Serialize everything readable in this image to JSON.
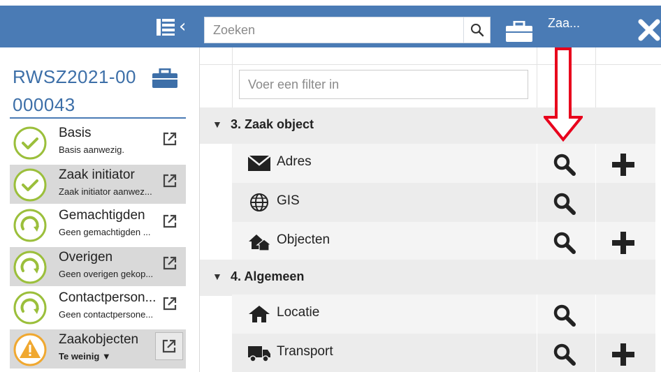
{
  "header": {
    "search_placeholder": "Zoeken",
    "title": "Zaa...",
    "collapse_glyph": "‹",
    "icons": [
      "list-icon",
      "chevron-left-icon",
      "search-icon",
      "briefcase-icon",
      "close-icon"
    ]
  },
  "case": {
    "id_line1": "RWSZ2021-00",
    "id_line2": "000043"
  },
  "steps": [
    {
      "title": "Basis",
      "subtitle": "Basis aanwezig.",
      "status": "complete"
    },
    {
      "title": "Zaak initiator",
      "subtitle": "Zaak initiator aanwez...",
      "status": "complete"
    },
    {
      "title": "Gemachtigden",
      "subtitle": "Geen gemachtigden ...",
      "status": "pending"
    },
    {
      "title": "Overigen",
      "subtitle": "Geen overigen gekop...",
      "status": "pending"
    },
    {
      "title": "Contactperson...",
      "subtitle": "Geen contactpersone...",
      "status": "pending"
    },
    {
      "title": "Zaakobjecten",
      "subtitle": "Te weinig ▼",
      "status": "warning"
    }
  ],
  "filter": {
    "placeholder": "Voer een filter in"
  },
  "groups": [
    {
      "title": "3. Zaak object",
      "items": [
        {
          "label": "Adres",
          "icon": "envelope-icon",
          "can_search": true,
          "can_add": true
        },
        {
          "label": "GIS",
          "icon": "globe-icon",
          "can_search": true,
          "can_add": false
        },
        {
          "label": "Objecten",
          "icon": "houses-icon",
          "can_search": true,
          "can_add": true
        }
      ]
    },
    {
      "title": "4. Algemeen",
      "items": [
        {
          "label": "Locatie",
          "icon": "house-icon",
          "can_search": true,
          "can_add": false
        },
        {
          "label": "Transport",
          "icon": "truck-icon",
          "can_search": true,
          "can_add": true
        }
      ]
    }
  ],
  "colors": {
    "header": "#4a7bb5",
    "case_id": "#3d6fa8",
    "complete": "#9bbf3b",
    "warning": "#f0a830",
    "annotation_arrow": "#e8001c"
  },
  "annotation": {
    "type": "down-arrow",
    "points_to": "search-action in 3. Zaak object"
  }
}
